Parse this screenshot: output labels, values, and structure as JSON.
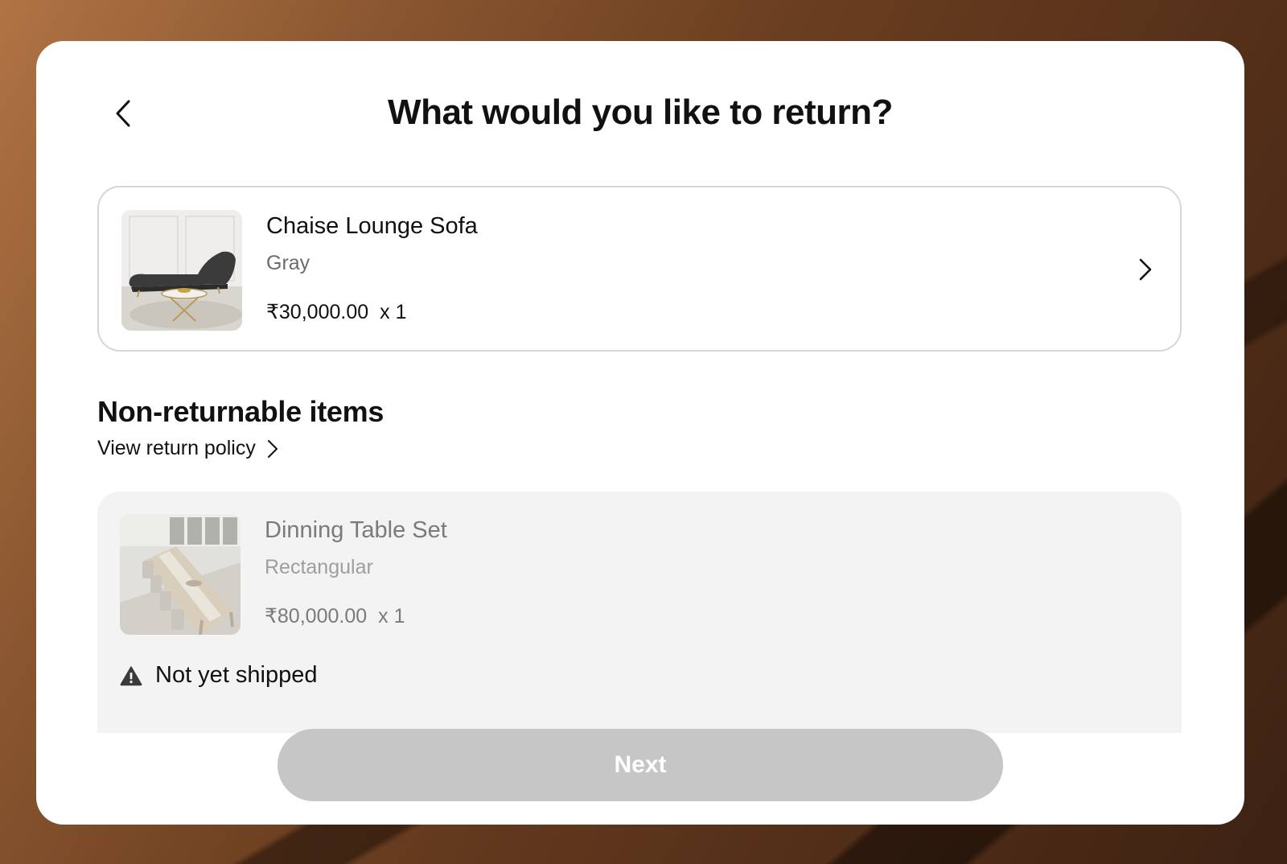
{
  "colors": {
    "card_background": "#ffffff",
    "disabled_button": "#c6c6c6",
    "non_returnable_background": "#f3f3f3",
    "text_primary": "#111111",
    "text_muted": "#7a7a7a"
  },
  "header": {
    "back_icon": "chevron-left-icon",
    "title": "What would you like to return?"
  },
  "returnable_items": [
    {
      "name": "Chaise Lounge Sofa",
      "variant": "Gray",
      "price": "₹30,000.00",
      "quantity": "x 1",
      "image": "gray chaise lounge sofa with round coffee table",
      "chevron_icon": "chevron-right-icon"
    }
  ],
  "non_returnable": {
    "heading": "Non-returnable items",
    "policy_link_label": "View return policy",
    "policy_link_icon": "chevron-right-icon",
    "items": [
      {
        "name": "Dinning Table Set",
        "variant": "Rectangular",
        "price": "₹80,000.00",
        "quantity": "x 1",
        "image": "long wooden dining table with upholstered chairs",
        "status_icon": "warning-icon",
        "status": "Not yet shipped"
      }
    ]
  },
  "footer": {
    "next_label": "Next",
    "next_enabled": false
  }
}
